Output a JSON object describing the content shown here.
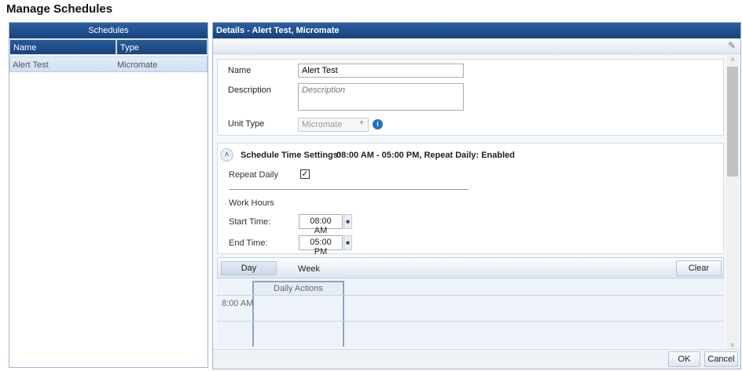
{
  "title": "Manage Schedules",
  "schedules": {
    "header": "Schedules",
    "columns": [
      "Name",
      "Type"
    ],
    "rows": [
      {
        "name": "Alert Test",
        "type": "Micromate"
      }
    ]
  },
  "details": {
    "header": "Details - Alert Test, Micromate",
    "name_label": "Name",
    "name_value": "Alert Test",
    "description_label": "Description",
    "description_placeholder": "Description",
    "unit_type_label": "Unit Type",
    "unit_type_value": "Micromate",
    "schedule_title": "Schedule Time Settings:",
    "schedule_summary": "08:00 AM - 05:00 PM, Repeat Daily: Enabled",
    "repeat_daily_label": "Repeat Daily",
    "repeat_daily_checked": true,
    "work_hours_label": "Work Hours",
    "start_time_label": "Start Time:",
    "start_time": "08:00 AM",
    "end_time_label": "End Time:",
    "end_time": "05:00 PM"
  },
  "calendar": {
    "tabs": [
      "Day",
      "Week"
    ],
    "clear": "Clear",
    "column": "Daily Actions",
    "time": "8:00 AM"
  },
  "footer": {
    "ok": "OK",
    "cancel": "Cancel"
  }
}
